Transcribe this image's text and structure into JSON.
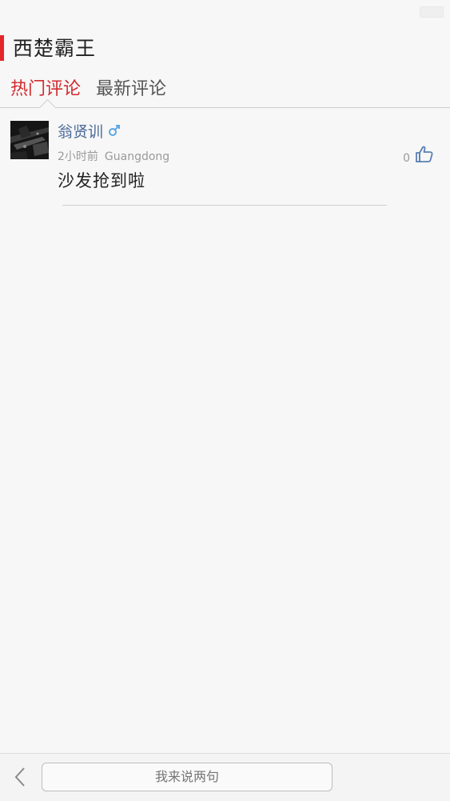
{
  "header": {
    "title": "西楚霸王"
  },
  "tabs": {
    "hot": "热门评论",
    "latest": "最新评论"
  },
  "comment": {
    "username": "翁贤训",
    "time": "2小时前",
    "location": "Guangdong",
    "text": "沙发抢到啦",
    "likes": "0"
  },
  "bottom": {
    "input_placeholder": "我来说两句"
  },
  "colors": {
    "accent": "#e5262b",
    "active_tab": "#d32a2f",
    "username": "#4a6a9a",
    "like_icon": "#5a7fb3",
    "gender_icon": "#5aa7e6"
  },
  "icons": {
    "gender": "male-icon",
    "like": "thumbs-up-icon",
    "back": "chevron-left-icon"
  }
}
